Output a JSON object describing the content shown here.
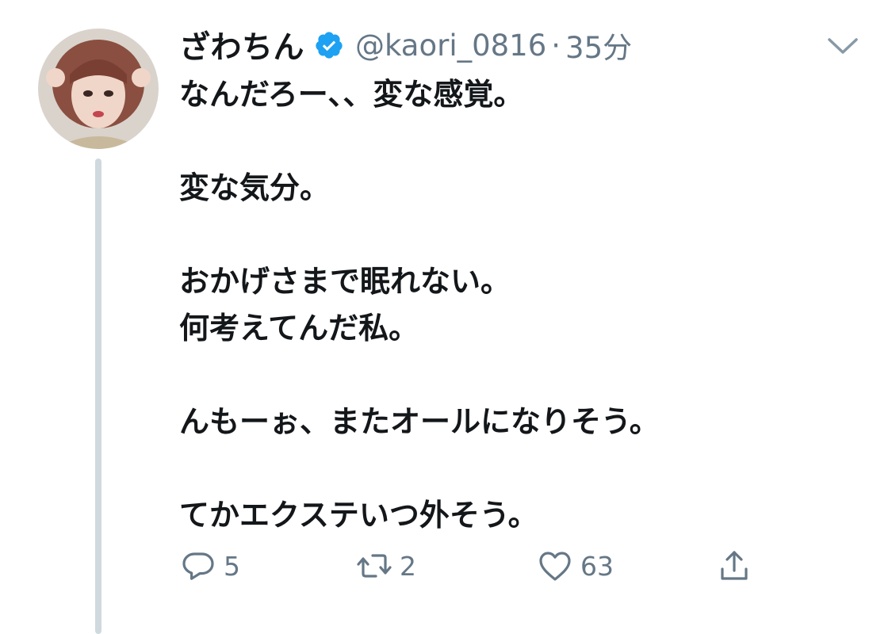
{
  "tweet": {
    "author": {
      "name": "ざわちん",
      "handle": "@kaori_0816",
      "verified": true,
      "avatar_icon": "profile-photo"
    },
    "separator": "·",
    "time": "35分",
    "body_lines": [
      "なんだろー、、変な感覚。",
      "",
      "変な気分。",
      "",
      "おかげさまで眠れない。",
      "何考えてんだ私。",
      "",
      "んもーぉ、またオールになりそう。",
      "",
      "てかエクステいつ外そう。"
    ],
    "actions": {
      "reply": {
        "icon": "reply-icon",
        "count": "5"
      },
      "retweet": {
        "icon": "retweet-icon",
        "count": "2"
      },
      "like": {
        "icon": "heart-icon",
        "count": "63"
      },
      "share": {
        "icon": "share-icon"
      }
    }
  },
  "colors": {
    "text": "#14171a",
    "muted": "#657786",
    "verified": "#1da1f2",
    "thread_line": "#cfd9de",
    "background": "#ffffff"
  }
}
